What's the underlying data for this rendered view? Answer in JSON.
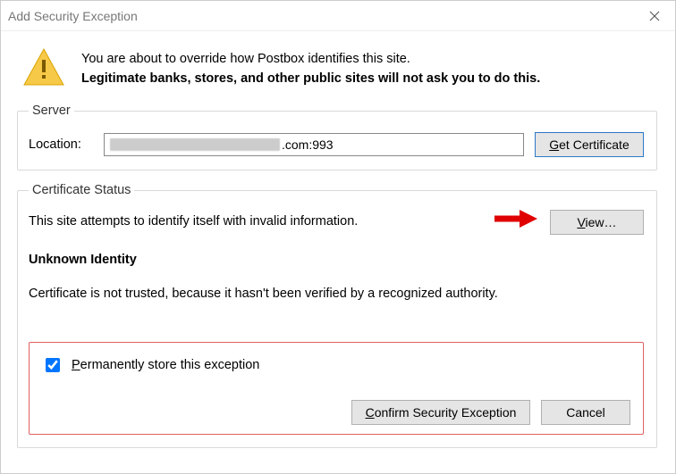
{
  "window": {
    "title": "Add Security Exception"
  },
  "intro": {
    "line1": "You are about to override how Postbox identifies this site.",
    "line2": "Legitimate banks, stores, and other public sites will not ask you to do this."
  },
  "server": {
    "legend": "Server",
    "location_label": "Location:",
    "location_suffix": ".com:993",
    "get_cert_label": "Get Certificate",
    "get_cert_u": "G"
  },
  "cert": {
    "legend": "Certificate Status",
    "status_text": "This site attempts to identify itself with invalid information.",
    "view_label": "View…",
    "view_u": "V",
    "unknown_heading": "Unknown Identity",
    "trust_text": "Certificate is not trusted, because it hasn't been verified by a recognized authority."
  },
  "footer": {
    "perm_label": "Permanently store this exception",
    "perm_u": "P",
    "perm_checked": true,
    "confirm_label": "Confirm Security Exception",
    "confirm_u": "C",
    "cancel_label": "Cancel"
  }
}
